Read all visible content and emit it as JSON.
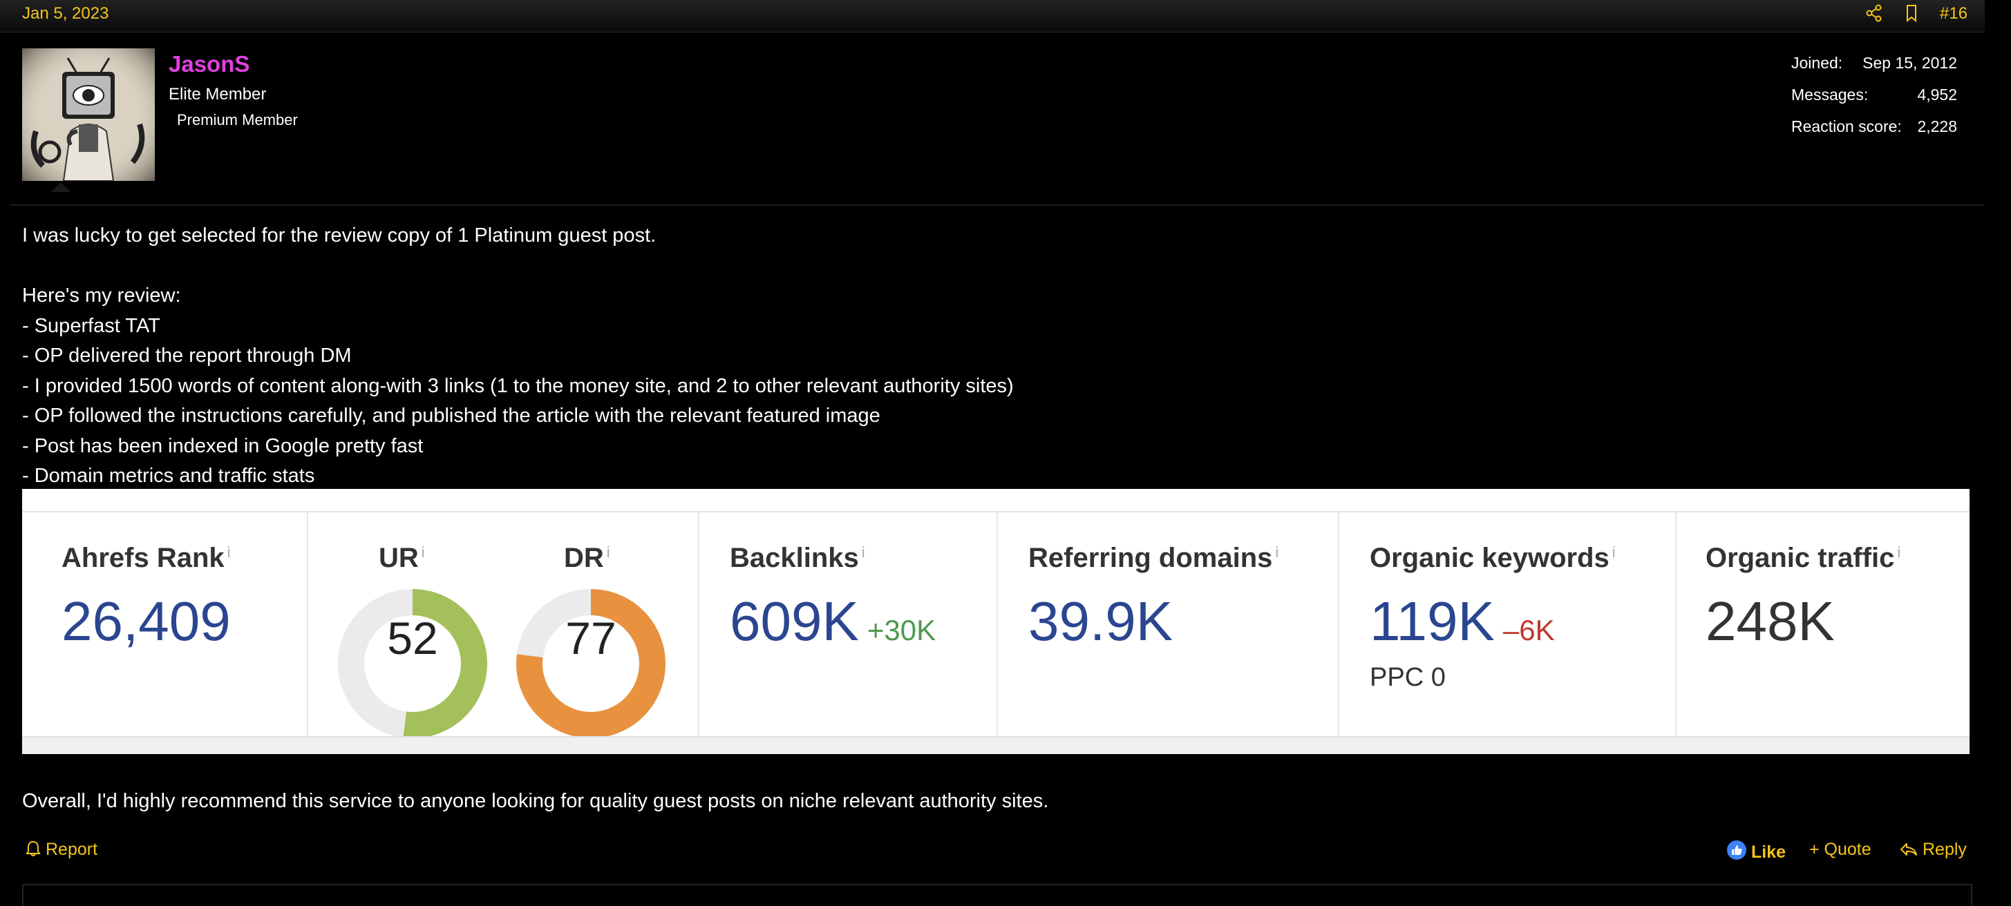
{
  "post": {
    "date": "Jan 5, 2023",
    "number": "#16",
    "icons": {
      "share": "share-icon",
      "bookmark": "bookmark-icon"
    }
  },
  "user": {
    "name": "JasonS",
    "title": "Elite Member",
    "banner": "Premium Member",
    "name_color": "#e040e0",
    "stats": [
      {
        "label": "Joined:",
        "value": "Sep 15, 2012"
      },
      {
        "label": "Messages:",
        "value": "4,952"
      },
      {
        "label": "Reaction score:",
        "value": "2,228"
      }
    ]
  },
  "body": {
    "intro": "I was lucky to get selected for the review copy of 1 Platinum guest post.",
    "review_heading": "Here's my review:",
    "points": [
      "- Superfast TAT",
      "- OP delivered the report through DM",
      "- I provided 1500 words of content along-with 3 links (1 to the money site, and 2 to other relevant authority sites)",
      "- OP followed the instructions carefully, and published the article with the relevant featured image",
      "- Post has been indexed in Google pretty fast",
      "- Domain metrics and traffic stats"
    ],
    "closing": "Overall, I'd highly recommend this service to anyone looking for quality guest posts on niche relevant authority sites."
  },
  "metrics": {
    "info_mark": "i",
    "ahrefs_rank": {
      "label": "Ahrefs Rank",
      "value": "26,409"
    },
    "ur": {
      "label": "UR",
      "value": "52",
      "score": 52,
      "color": "#a3c05a"
    },
    "dr": {
      "label": "DR",
      "value": "77",
      "score": 77,
      "color": "#e8923f"
    },
    "backlinks": {
      "label": "Backlinks",
      "value": "609K",
      "delta": "+30K"
    },
    "referring_domains": {
      "label": "Referring domains",
      "value": "39.9K"
    },
    "organic_keywords": {
      "label": "Organic keywords",
      "value": "119K",
      "delta": "–6K",
      "ppc": "PPC 0"
    },
    "organic_traffic": {
      "label": "Organic traffic",
      "value": "248K"
    }
  },
  "actions": {
    "report": "Report",
    "like": "Like",
    "quote": "+ Quote",
    "reply": "Reply"
  },
  "colors": {
    "accent": "#f5c518",
    "metric_blue": "#2b4690"
  }
}
